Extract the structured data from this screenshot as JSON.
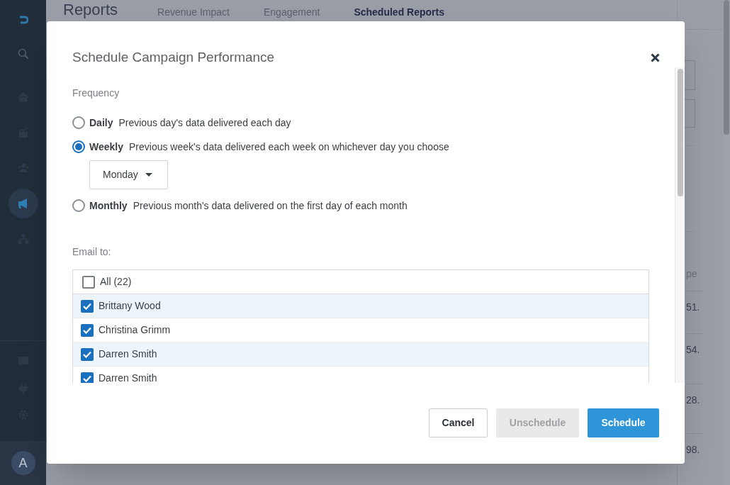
{
  "sidebar": {
    "nav_items": [
      {
        "selected": false
      },
      {
        "selected": false
      },
      {
        "selected": false
      },
      {
        "selected": true
      },
      {
        "selected": false
      }
    ],
    "avatar": {
      "initial": "A"
    }
  },
  "page": {
    "title": "Reports",
    "tabs": [
      {
        "label": "Revenue Impact",
        "selected": false
      },
      {
        "label": "Engagement",
        "selected": false
      },
      {
        "label": "Scheduled Reports",
        "selected": true
      }
    ],
    "table": {
      "column_header": "pe",
      "cells": [
        "51.",
        "54.",
        "28.",
        "98."
      ]
    }
  },
  "dialog": {
    "title": "Schedule Campaign Performance",
    "frequency_label": "Frequency",
    "options": [
      {
        "name": "Daily",
        "description": "Previous day's data delivered each day",
        "selected": false
      },
      {
        "name": "Weekly",
        "description": "Previous week's data delivered each week on whichever day you choose",
        "selected": true,
        "day_select": {
          "value": "Monday"
        }
      },
      {
        "name": "Monthly",
        "description": "Previous month's data delivered on the first day of each month",
        "selected": false
      }
    ],
    "email_label": "Email to:",
    "select_all": {
      "label": "All (22)",
      "checked": false
    },
    "recipients": [
      {
        "name": "Brittany Wood",
        "checked": true
      },
      {
        "name": "Christina Grimm",
        "checked": true
      },
      {
        "name": "Darren Smith",
        "checked": true
      },
      {
        "name": "Darren Smith",
        "checked": true
      }
    ],
    "buttons": [
      {
        "label": "Cancel",
        "kind": "secondary"
      },
      {
        "label": "Unschedule",
        "kind": "disabled"
      },
      {
        "label": "Schedule",
        "kind": "primary"
      }
    ]
  }
}
